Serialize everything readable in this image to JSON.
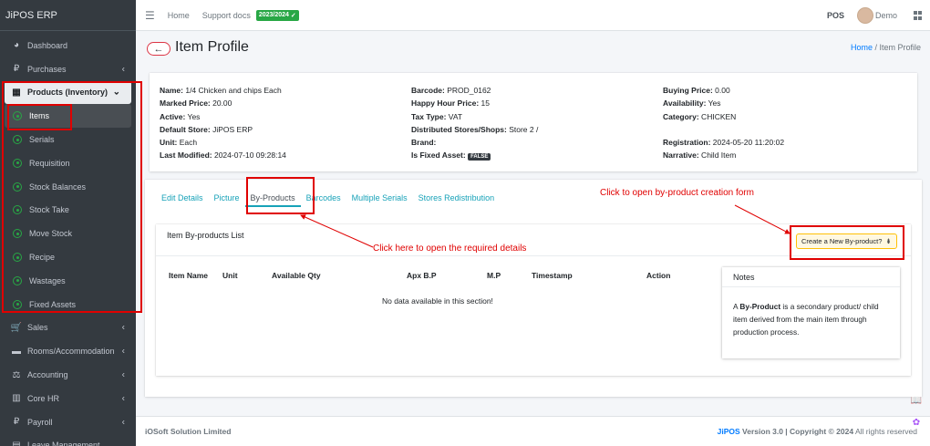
{
  "sidebar": {
    "brand": "JiPOS ERP",
    "items": [
      {
        "label": "Dashboard",
        "icon": "dashboard-icon",
        "glyph": "◕"
      },
      {
        "label": "Purchases",
        "icon": "ruble-icon",
        "glyph": "₽"
      },
      {
        "label": "Products (Inventory)",
        "icon": "table-icon",
        "glyph": "▦"
      },
      {
        "label": "Items"
      },
      {
        "label": "Serials"
      },
      {
        "label": "Requisition"
      },
      {
        "label": "Stock Balances"
      },
      {
        "label": "Stock Take"
      },
      {
        "label": "Move Stock"
      },
      {
        "label": "Recipe"
      },
      {
        "label": "Wastages"
      },
      {
        "label": "Fixed Assets"
      },
      {
        "label": "Sales",
        "icon": "cart-icon",
        "glyph": "🛒"
      },
      {
        "label": "Rooms/Accommodation",
        "icon": "bed-icon",
        "glyph": "▬"
      },
      {
        "label": "Accounting",
        "icon": "scale-icon",
        "glyph": "⚖"
      },
      {
        "label": "Core HR",
        "icon": "building-icon",
        "glyph": "▥"
      },
      {
        "label": "Payroll",
        "icon": "ruble-icon",
        "glyph": "₽"
      },
      {
        "label": "Leave Management",
        "icon": "calendar-icon",
        "glyph": "▤"
      }
    ]
  },
  "topbar": {
    "home": "Home",
    "support": "Support docs",
    "year": "2023/2024",
    "pos": "POS",
    "user": "Demo"
  },
  "header": {
    "title": "Item Profile",
    "crumb_home": "Home",
    "crumb_sep": " / ",
    "crumb_current": "Item Profile"
  },
  "info": {
    "col1": [
      {
        "k": "Name:",
        "v": " 1/4 Chicken and chips Each"
      },
      {
        "k": "Marked Price:",
        "v": " 20.00"
      },
      {
        "k": "Active:",
        "v": " Yes"
      },
      {
        "k": "Default Store:",
        "v": " JiPOS ERP"
      },
      {
        "k": "Unit:",
        "v": " Each"
      },
      {
        "k": "Last Modified:",
        "v": " 2024-07-10 09:28:14"
      }
    ],
    "col2": [
      {
        "k": "Barcode:",
        "v": " PROD_0162"
      },
      {
        "k": "Happy Hour Price:",
        "v": " 15"
      },
      {
        "k": "Tax Type:",
        "v": " VAT"
      },
      {
        "k": "Distributed Stores/Shops:",
        "v": " Store 2 /"
      },
      {
        "k": "Brand:",
        "v": ""
      },
      {
        "k": "Is Fixed Asset:",
        "v": ""
      }
    ],
    "fixed_asset_badge": "FALSE",
    "col3": [
      {
        "k": "Buying Price:",
        "v": " 0.00"
      },
      {
        "k": "Availability:",
        "v": " Yes"
      },
      {
        "k": "Category:",
        "v": " CHICKEN"
      },
      {
        "k": "",
        "v": ""
      },
      {
        "k": "Registration:",
        "v": " 2024-05-20 11:20:02"
      },
      {
        "k": "Narrative:",
        "v": " Child Item"
      }
    ]
  },
  "tabs": [
    "Edit Details",
    "Picture",
    "By-Products",
    "Barcodes",
    "Multiple Serials",
    "Stores Redistribution"
  ],
  "byproducts": {
    "title": "Item By-products List",
    "create_label": "Create a New By-product?",
    "columns": [
      "Item Name",
      "Unit",
      "Available Qty",
      "Apx B.P",
      "M.P",
      "Timestamp",
      "Action"
    ],
    "empty": "No data available in this section!"
  },
  "notes": {
    "title": "Notes",
    "pre": "A ",
    "bold": "By-Product",
    "post": " is a secondary product/ child item derived from the main item through production process."
  },
  "annotations": {
    "create_hint": "Click to open by-product creation form",
    "tab_hint": "Click here to open the required details",
    "color": "#e00000"
  },
  "footer": {
    "company": "iOSoft Solution Limited",
    "brand": "JiPOS",
    "version_text": " Version 3.0 | Copyright © 2024",
    "rights": " All rights reserved"
  }
}
